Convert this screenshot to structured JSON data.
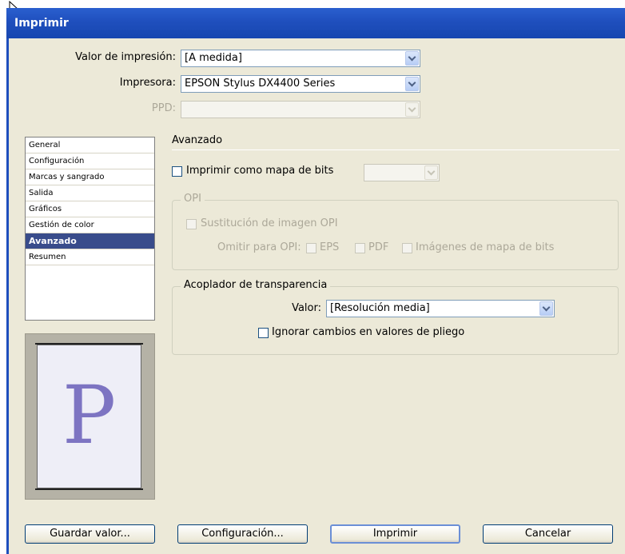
{
  "window": {
    "title": "Imprimir"
  },
  "top_fields": {
    "preset_label": "Valor de impresión:",
    "preset_value": "[A medida]",
    "printer_label": "Impresora:",
    "printer_value": "EPSON Stylus DX4400 Series",
    "ppd_label": "PPD:",
    "ppd_value": ""
  },
  "nav": {
    "items": [
      {
        "label": "General"
      },
      {
        "label": "Configuración"
      },
      {
        "label": "Marcas y sangrado"
      },
      {
        "label": "Salida"
      },
      {
        "label": "Gráficos"
      },
      {
        "label": "Gestión de color"
      },
      {
        "label": "Avanzado"
      },
      {
        "label": "Resumen"
      }
    ],
    "selected": "Avanzado"
  },
  "preview": {
    "letter": "P"
  },
  "advanced": {
    "title": "Avanzado",
    "print_as_bitmap": {
      "label": "Imprimir como mapa de bits",
      "checked": false,
      "resolution_value": ""
    },
    "opi": {
      "group_label": "OPI",
      "image_replacement": {
        "label": "Sustitución de imagen OPI",
        "checked": false
      },
      "omit_label": "Omitir para OPI:",
      "omit_eps": {
        "label": "EPS",
        "checked": false
      },
      "omit_pdf": {
        "label": "PDF",
        "checked": false
      },
      "omit_bitmap": {
        "label": "Imágenes de mapa de bits",
        "checked": false
      }
    },
    "flattener": {
      "group_label": "Acoplador de transparencia",
      "preset_label": "Valor:",
      "preset_value": "[Resolución media]",
      "ignore_overrides": {
        "label": "Ignorar cambios en valores de pliego",
        "checked": false
      }
    }
  },
  "buttons": {
    "save_preset": "Guardar valor...",
    "setup": "Configuración...",
    "print": "Imprimir",
    "cancel": "Cancelar"
  }
}
